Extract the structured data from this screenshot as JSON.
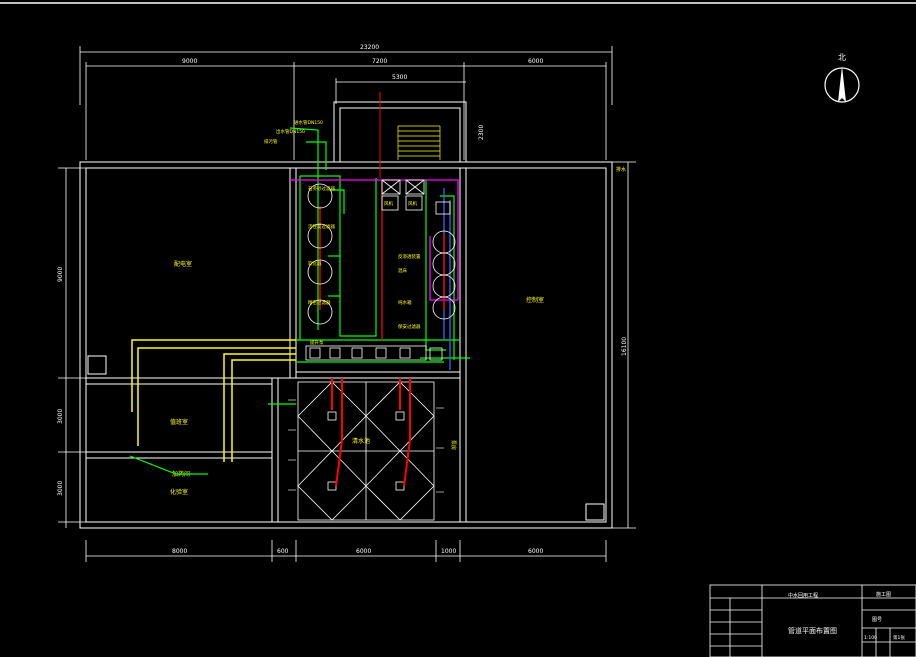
{
  "drawing": {
    "title": "管道平面布置图",
    "north_label": "北",
    "dimensions": {
      "total_width": "23200",
      "top_left": "9000",
      "top_middle": "7200",
      "top_right": "6000",
      "stair_width": "5300",
      "stair_depth": "2300",
      "bottom_left": "8000",
      "bottom_gap_left": "600",
      "bottom_middle": "6000",
      "bottom_gap_right": "1000",
      "bottom_right": "6000",
      "left_upper": "9000",
      "left_middle": "3000",
      "left_lower": "3000",
      "right_total": "16100"
    },
    "rooms": {
      "left_upper": "配电室",
      "left_middle": "值班室",
      "left_lower_1": "加药间",
      "left_lower_2": "化验室",
      "right": "控制室",
      "bottom_center": "清水池",
      "drain": "排水"
    },
    "labels": {
      "inlet_1": "进水管DN150",
      "inlet_2": "出水管DN150",
      "inlet_3": "排污管",
      "tank_left_1": "石英砂过滤器",
      "tank_left_2": "活性炭过滤器",
      "tank_left_3": "软化器",
      "tank_left_4": "精密过滤器",
      "tank_right_1": "反渗透装置",
      "tank_right_2": "混床",
      "tank_right_3": "纯水箱",
      "tank_right_4": "保安过滤器",
      "pump_row": "提升泵",
      "fan_1": "风机",
      "fan_2": "风机",
      "right_col": "泵房"
    },
    "title_block": {
      "company": "中水回用工程",
      "drawing_no": "图号",
      "stage": "施工图",
      "scale": "1:100",
      "sheet": "第1张"
    }
  }
}
